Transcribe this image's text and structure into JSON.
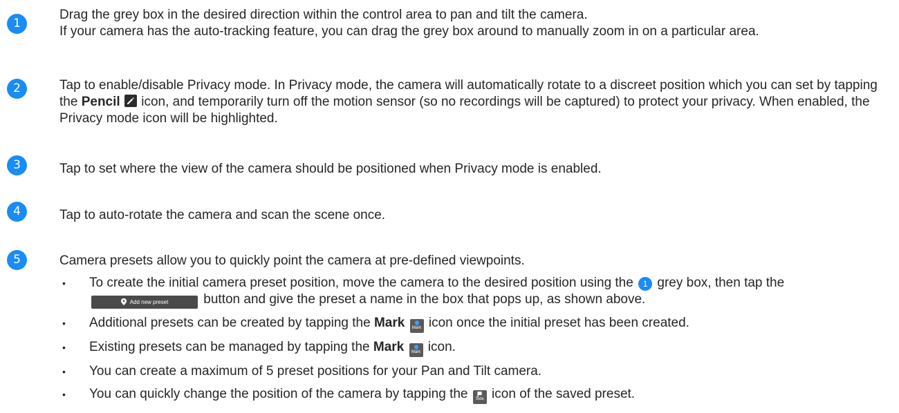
{
  "colors": {
    "accent": "#1a8cf5",
    "text": "#262626"
  },
  "steps": [
    {
      "number": "1",
      "lines": [
        "Drag the grey box in the desired direction within the control area to pan and tilt the camera.",
        "If your camera has the auto-tracking feature, you can drag the grey box around to manually zoom in on a particular area."
      ]
    },
    {
      "number": "2",
      "text_a": "Tap to enable/disable Privacy mode. In Privacy mode, the camera will automatically rotate to a discreet position which you can set by tapping the ",
      "bold": "Pencil",
      "icon": "pencil-icon",
      "text_b": " icon, and temporarily turn off the motion sensor (so no recordings will be captured) to protect your privacy. When enabled, the Privacy mode icon will be highlighted."
    },
    {
      "number": "3",
      "text": "Tap to set where the view of the camera should be positioned when Privacy mode is enabled."
    },
    {
      "number": "4",
      "text": "Tap to auto-rotate the camera and scan the scene once."
    },
    {
      "number": "5",
      "intro": "Camera presets allow you to quickly point the camera at pre-defined viewpoints.",
      "bullet_char": "•",
      "bullets": {
        "b1": {
          "a": "To create the initial camera preset position, move the camera to the desired position using the ",
          "badge": "1",
          "b": " grey box, then tap the ",
          "button_label": "Add new preset",
          "c": " button and give the preset a name in the box that pops up, as shown above."
        },
        "b2": {
          "a": "Additional presets can be created by tapping the ",
          "bold": "Mark",
          "icon_label": "Mark",
          "b": " icon once the initial preset has been created."
        },
        "b3": {
          "a": "Existing presets can be managed by tapping the ",
          "bold": "Mark",
          "icon_label": "Mark",
          "b": " icon."
        },
        "b4": {
          "text": "You can create a maximum of 5 preset positions for your Pan and Tilt camera."
        },
        "b5": {
          "a": "You can quickly change the position of the camera by tapping the ",
          "icon_label": "Side",
          "b": " icon of the saved preset."
        }
      }
    }
  ]
}
